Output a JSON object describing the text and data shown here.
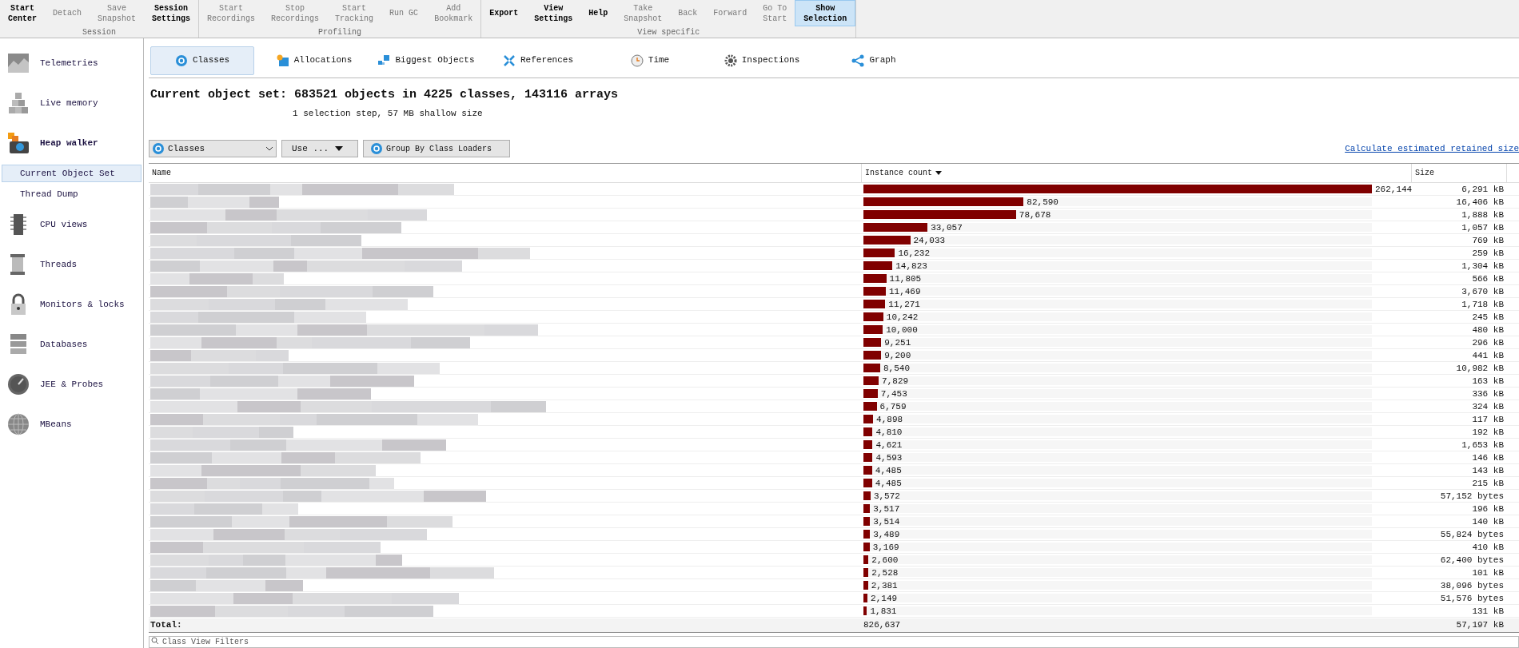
{
  "toolbar": {
    "groups": [
      {
        "label": "Session",
        "buttons": [
          {
            "label": "Start\nCenter",
            "disabled": false,
            "selected": false
          },
          {
            "label": "Detach",
            "disabled": true,
            "selected": false
          },
          {
            "label": "Save\nSnapshot",
            "disabled": true,
            "selected": false
          },
          {
            "label": "Session\nSettings",
            "disabled": false,
            "selected": false
          }
        ]
      },
      {
        "label": "Profiling",
        "buttons": [
          {
            "label": "Start\nRecordings",
            "disabled": true,
            "selected": false
          },
          {
            "label": "Stop\nRecordings",
            "disabled": true,
            "selected": false
          },
          {
            "label": "Start\nTracking",
            "disabled": true,
            "selected": false
          },
          {
            "label": "Run GC",
            "disabled": true,
            "selected": false
          },
          {
            "label": "Add\nBookmark",
            "disabled": true,
            "selected": false
          }
        ]
      },
      {
        "label": "View specific",
        "buttons": [
          {
            "label": "Export",
            "disabled": false,
            "selected": false
          },
          {
            "label": "View\nSettings",
            "disabled": false,
            "selected": false
          },
          {
            "label": "Help",
            "disabled": false,
            "selected": false
          },
          {
            "label": "Take\nSnapshot",
            "disabled": true,
            "selected": false
          },
          {
            "label": "Back",
            "disabled": true,
            "selected": false
          },
          {
            "label": "Forward",
            "disabled": true,
            "selected": false
          },
          {
            "label": "Go To\nStart",
            "disabled": true,
            "selected": false
          },
          {
            "label": "Show\nSelection",
            "disabled": false,
            "selected": true
          }
        ]
      }
    ]
  },
  "sidebar": {
    "items": [
      {
        "label": "Telemetries",
        "kind": "telemetry",
        "expanded": false
      },
      {
        "label": "Live memory",
        "kind": "memory",
        "expanded": false
      },
      {
        "label": "Heap walker",
        "kind": "heap",
        "expanded": true,
        "children": [
          {
            "label": "Current Object Set",
            "selected": true
          },
          {
            "label": "Thread Dump",
            "selected": false
          }
        ]
      },
      {
        "label": "CPU views",
        "kind": "cpu",
        "expanded": false
      },
      {
        "label": "Threads",
        "kind": "threads",
        "expanded": false
      },
      {
        "label": "Monitors & locks",
        "kind": "lock",
        "expanded": false
      },
      {
        "label": "Databases",
        "kind": "database",
        "expanded": false
      },
      {
        "label": "JEE & Probes",
        "kind": "probe",
        "expanded": false
      },
      {
        "label": "MBeans",
        "kind": "mbeans",
        "expanded": false
      }
    ]
  },
  "tabs": [
    {
      "label": "Classes",
      "kind": "classes",
      "selected": true
    },
    {
      "label": "Allocations",
      "kind": "allocations",
      "selected": false
    },
    {
      "label": "Biggest Objects",
      "kind": "biggest",
      "selected": false
    },
    {
      "label": "References",
      "kind": "references",
      "selected": false
    },
    {
      "label": "Time",
      "kind": "time",
      "selected": false
    },
    {
      "label": "Inspections",
      "kind": "inspections",
      "selected": false
    },
    {
      "label": "Graph",
      "kind": "graph",
      "selected": false
    }
  ],
  "heading": "Current object set: 683521 objects in 4225 classes, 143116 arrays",
  "subheading": "1 selection step, 57 MB shallow size",
  "controls": {
    "view_select": "Classes",
    "use_button": "Use ...",
    "group_button": "Group By Class Loaders",
    "retained_link": "Calculate estimated retained size"
  },
  "table": {
    "columns": [
      {
        "label": "Name",
        "sorted": false
      },
      {
        "label": "Instance count",
        "sorted": true
      },
      {
        "label": "Size",
        "sorted": false
      }
    ],
    "rows": [
      {
        "count": "262,144",
        "level": 1.0,
        "size": "6,291 kB"
      },
      {
        "count": "82,590",
        "level": 0.315,
        "size": "16,406 kB"
      },
      {
        "count": "78,678",
        "level": 0.3,
        "size": "1,888 kB"
      },
      {
        "count": "33,057",
        "level": 0.126,
        "size": "1,057 kB"
      },
      {
        "count": "24,033",
        "level": 0.092,
        "size": "769 kB"
      },
      {
        "count": "16,232",
        "level": 0.062,
        "size": "259 kB"
      },
      {
        "count": "14,823",
        "level": 0.057,
        "size": "1,304 kB"
      },
      {
        "count": "11,805",
        "level": 0.045,
        "size": "566 kB"
      },
      {
        "count": "11,469",
        "level": 0.044,
        "size": "3,670 kB"
      },
      {
        "count": "11,271",
        "level": 0.043,
        "size": "1,718 kB"
      },
      {
        "count": "10,242",
        "level": 0.039,
        "size": "245 kB"
      },
      {
        "count": "10,000",
        "level": 0.038,
        "size": "480 kB"
      },
      {
        "count": "9,251",
        "level": 0.035,
        "size": "296 kB"
      },
      {
        "count": "9,200",
        "level": 0.035,
        "size": "441 kB"
      },
      {
        "count": "8,540",
        "level": 0.033,
        "size": "10,982 kB"
      },
      {
        "count": "7,829",
        "level": 0.03,
        "size": "163 kB"
      },
      {
        "count": "7,453",
        "level": 0.028,
        "size": "336 kB"
      },
      {
        "count": "6,759",
        "level": 0.026,
        "size": "324 kB"
      },
      {
        "count": "4,898",
        "level": 0.019,
        "size": "117 kB"
      },
      {
        "count": "4,810",
        "level": 0.018,
        "size": "192 kB"
      },
      {
        "count": "4,621",
        "level": 0.018,
        "size": "1,653 kB"
      },
      {
        "count": "4,593",
        "level": 0.018,
        "size": "146 kB"
      },
      {
        "count": "4,485",
        "level": 0.017,
        "size": "143 kB"
      },
      {
        "count": "4,485",
        "level": 0.017,
        "size": "215 kB"
      },
      {
        "count": "3,572",
        "level": 0.014,
        "size": "57,152 bytes"
      },
      {
        "count": "3,517",
        "level": 0.013,
        "size": "196 kB"
      },
      {
        "count": "3,514",
        "level": 0.013,
        "size": "140 kB"
      },
      {
        "count": "3,489",
        "level": 0.013,
        "size": "55,824 bytes"
      },
      {
        "count": "3,169",
        "level": 0.012,
        "size": "410 kB"
      },
      {
        "count": "2,600",
        "level": 0.01,
        "size": "62,400 bytes"
      },
      {
        "count": "2,528",
        "level": 0.01,
        "size": "101 kB"
      },
      {
        "count": "2,381",
        "level": 0.009,
        "size": "38,096 bytes"
      },
      {
        "count": "2,149",
        "level": 0.008,
        "size": "51,576 bytes"
      },
      {
        "count": "1,831",
        "level": 0.007,
        "size": "131 kB"
      }
    ],
    "total": {
      "label": "Total:",
      "count": "826,637",
      "size": "57,197 kB"
    }
  },
  "filter": {
    "placeholder": "Class View Filters"
  }
}
